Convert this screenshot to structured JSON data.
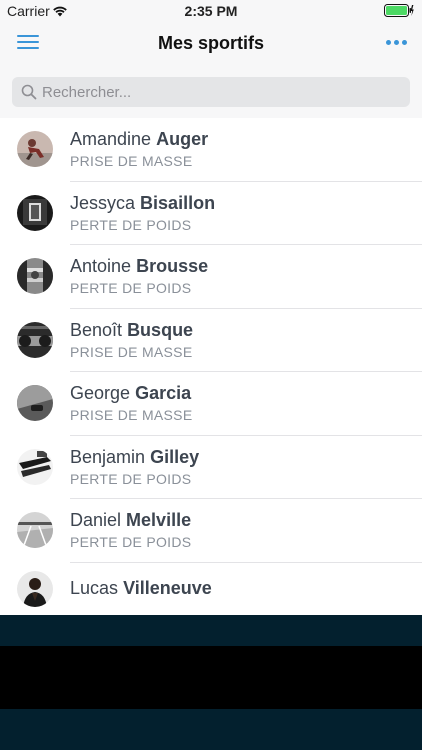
{
  "status_bar": {
    "carrier": "Carrier",
    "time": "2:35 PM"
  },
  "nav": {
    "title": "Mes sportifs"
  },
  "search": {
    "placeholder": "Rechercher..."
  },
  "colors": {
    "accent": "#3a95d8",
    "name_text": "#3d4550",
    "goal_text": "#8a9099",
    "bottom_band": "#03202e"
  },
  "athletes": [
    {
      "first": "Amandine",
      "last": "Auger",
      "goal": "PRISE DE MASSE"
    },
    {
      "first": "Jessyca",
      "last": "Bisaillon",
      "goal": "PERTE DE POIDS"
    },
    {
      "first": "Antoine",
      "last": "Brousse",
      "goal": "PERTE DE POIDS"
    },
    {
      "first": "Benoît",
      "last": "Busque",
      "goal": "PRISE DE MASSE"
    },
    {
      "first": "George",
      "last": "Garcia",
      "goal": "PRISE DE MASSE"
    },
    {
      "first": "Benjamin",
      "last": "Gilley",
      "goal": "PERTE DE POIDS"
    },
    {
      "first": "Daniel",
      "last": "Melville",
      "goal": "PERTE DE POIDS"
    },
    {
      "first": "Lucas",
      "last": "Villeneuve",
      "goal": ""
    }
  ]
}
